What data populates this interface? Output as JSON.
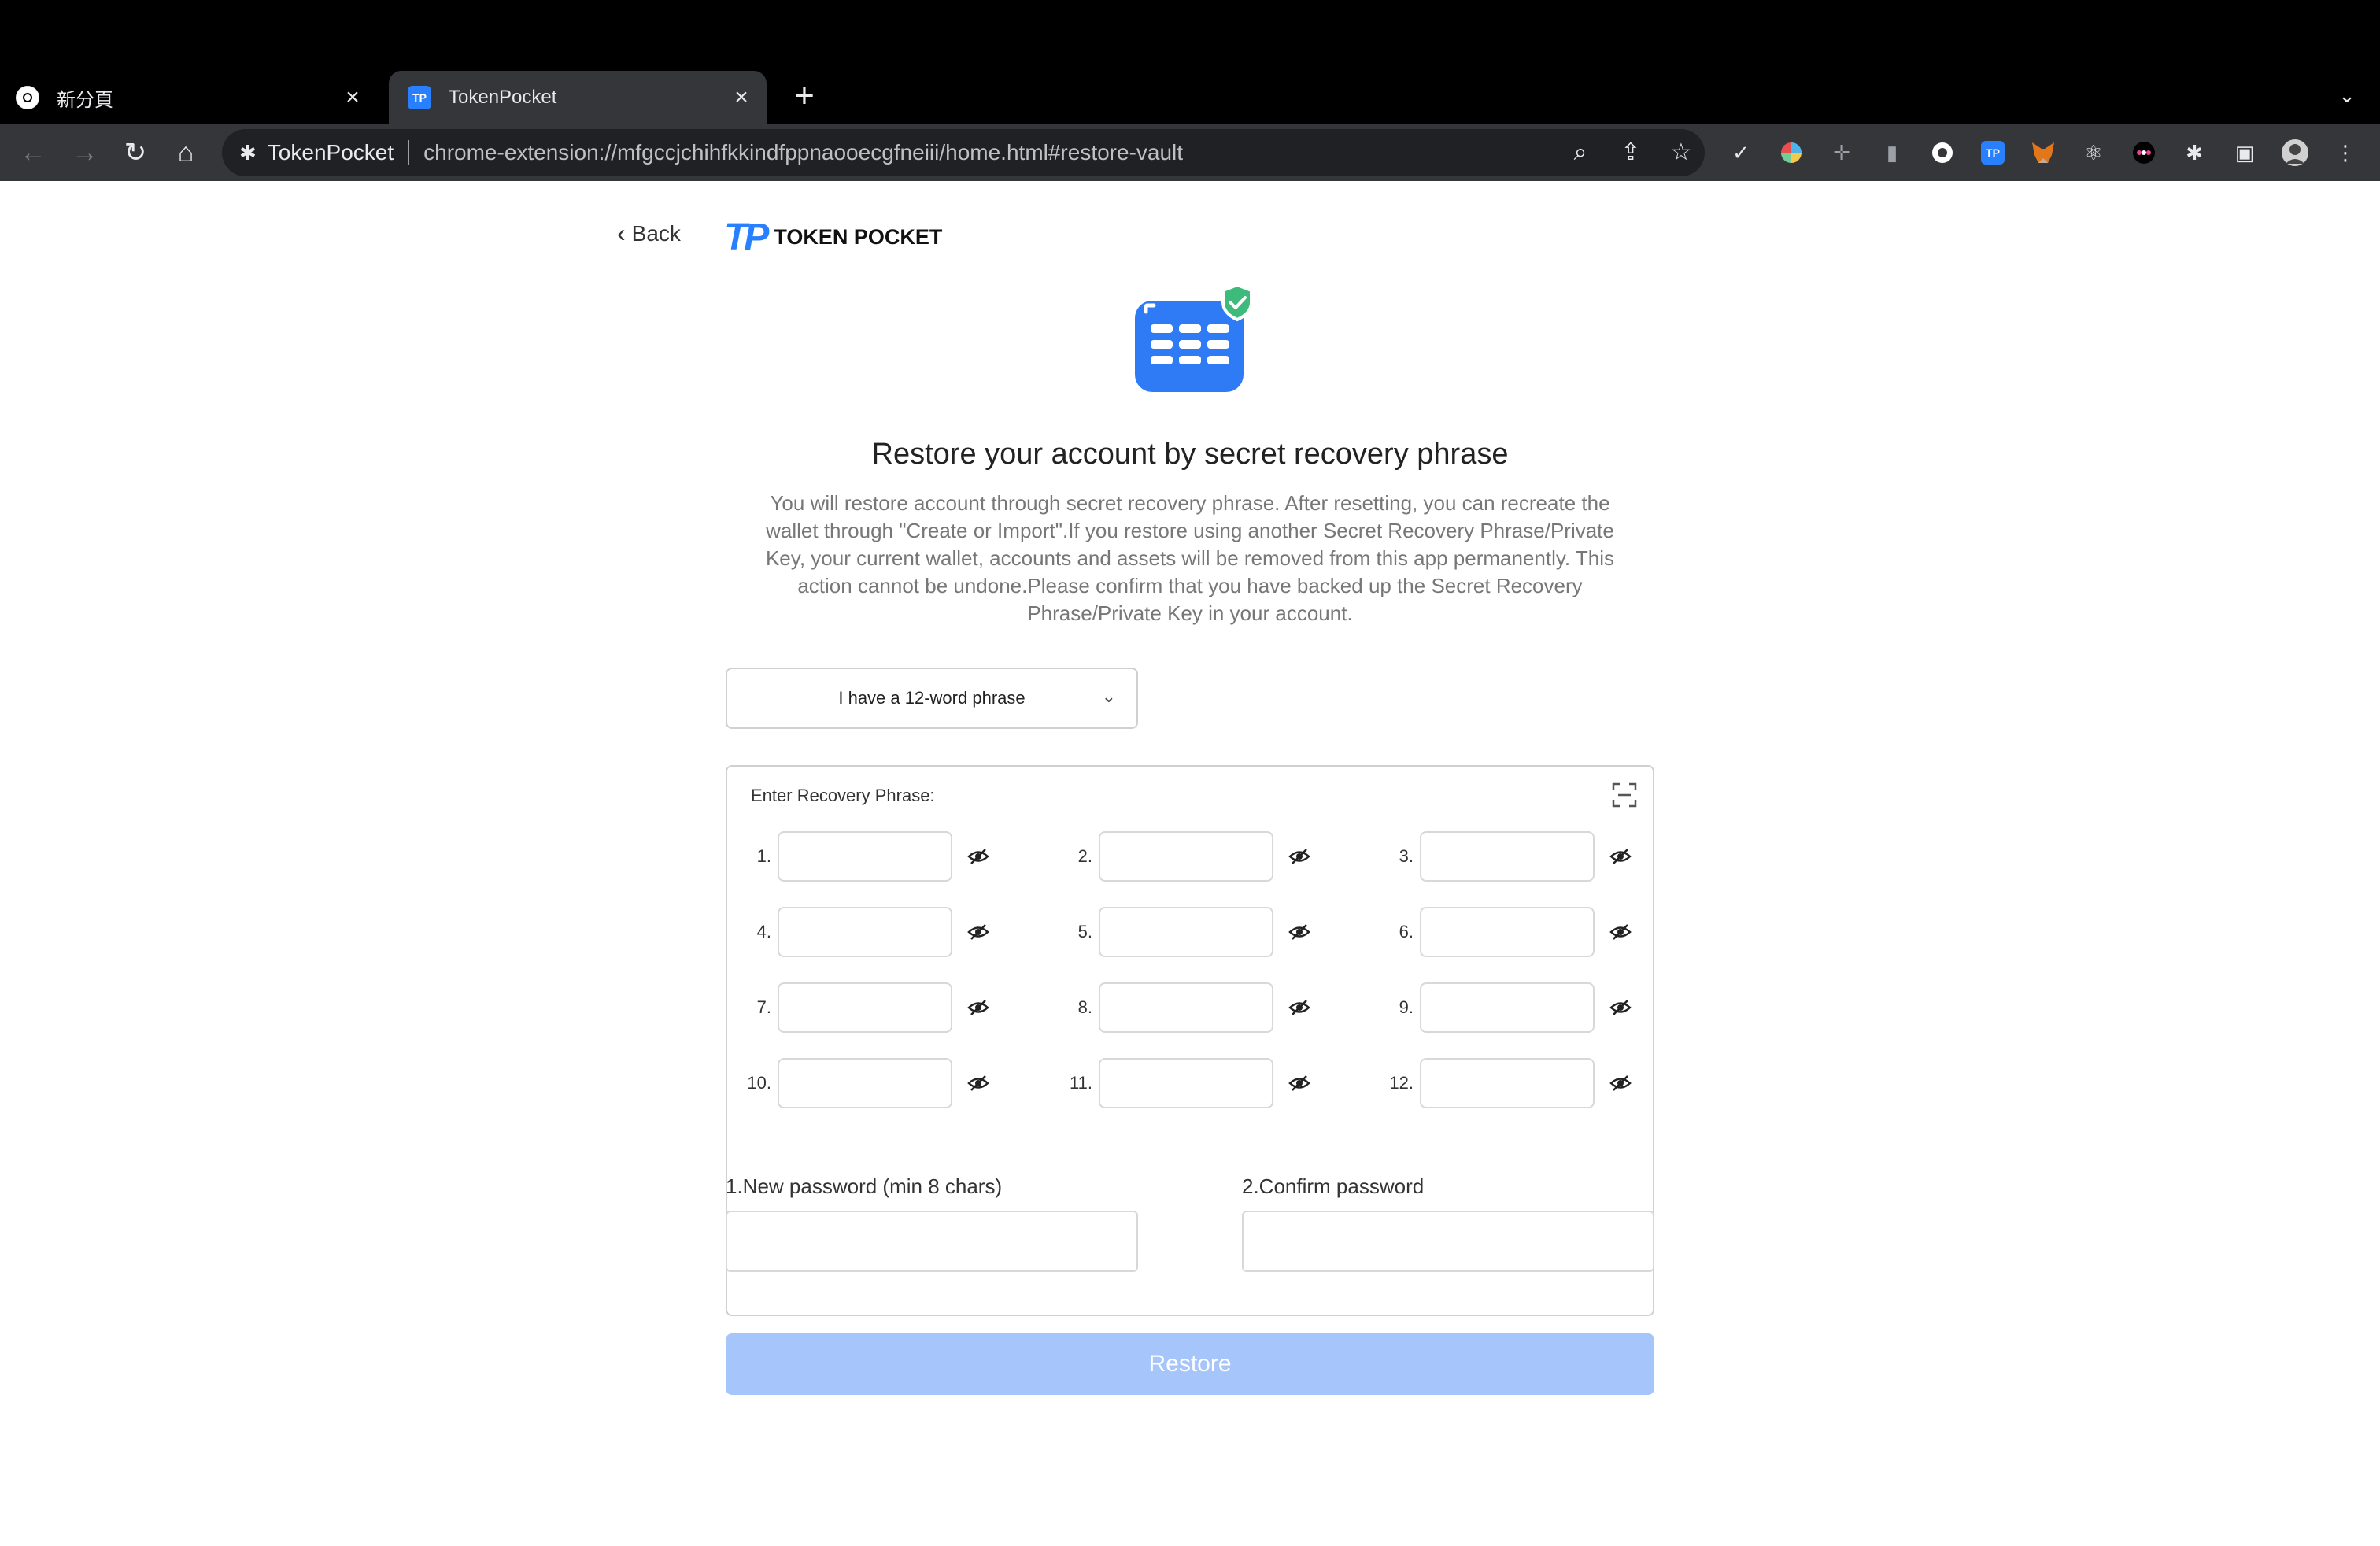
{
  "browser": {
    "tabs": [
      {
        "title": "新分頁",
        "active": false
      },
      {
        "title": "TokenPocket",
        "active": true
      }
    ],
    "omnibox": {
      "site_name": "TokenPocket",
      "url": "chrome-extension://mfgccjchihfkkindfppnaooecgfneiii/home.html#restore-vault"
    }
  },
  "page": {
    "back_label": "Back",
    "brand_name": "TOKEN POCKET",
    "brand_logo": "TP",
    "title": "Restore your account by secret recovery phrase",
    "description": "You will restore account through secret recovery phrase. After resetting, you can recreate the wallet through \"Create or Import\".If you restore using another Secret Recovery Phrase/Private Key, your current wallet, accounts and assets will be removed from this app permanently. This action cannot be undone.Please confirm that you have backed up the Secret Recovery Phrase/Private Key in your account.",
    "phrase_select": {
      "selected": "I have a 12-word phrase"
    },
    "phrase_box": {
      "label": "Enter Recovery Phrase:",
      "numbers": [
        "1.",
        "2.",
        "3.",
        "4.",
        "5.",
        "6.",
        "7.",
        "8.",
        "9.",
        "10.",
        "11.",
        "12."
      ]
    },
    "new_password_label": "1.New password (min 8 chars)",
    "confirm_password_label": "2.Confirm password",
    "restore_label": "Restore"
  },
  "colors": {
    "brand_blue": "#2980fe",
    "restore_disabled": "#a5c5fb",
    "shield_green": "#3dbb7a"
  }
}
